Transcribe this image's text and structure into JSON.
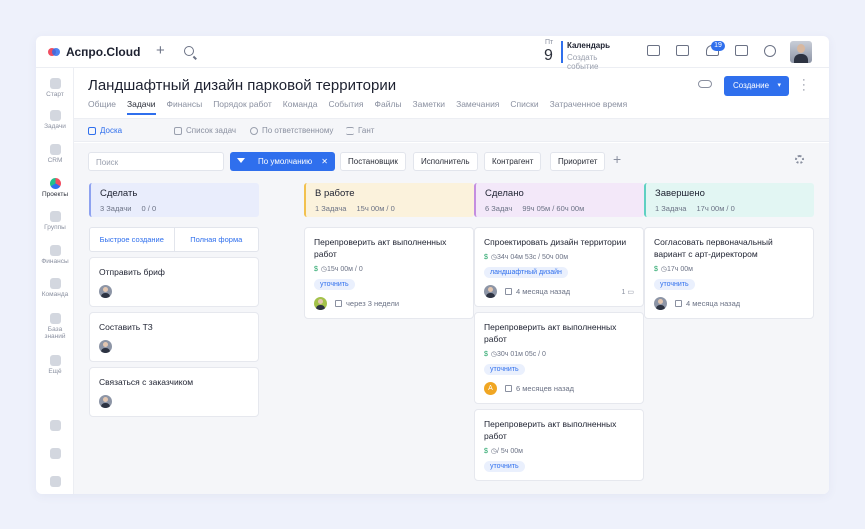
{
  "app": {
    "name": "Аспро.Cloud"
  },
  "calendar": {
    "weekday": "Пт",
    "day": "9",
    "title": "Календарь",
    "subtitle": "Создать событие"
  },
  "notifications": {
    "count": "19"
  },
  "sidebar": {
    "items": [
      {
        "label": "Старт",
        "icon": "home-icon"
      },
      {
        "label": "Задачи",
        "icon": "check-icon"
      },
      {
        "label": "CRM",
        "icon": "crm-icon"
      },
      {
        "label": "Проекты",
        "icon": "projects-icon",
        "active": true
      },
      {
        "label": "Группы",
        "icon": "groups-icon"
      },
      {
        "label": "Финансы",
        "icon": "finance-icon"
      },
      {
        "label": "Команда",
        "icon": "team-icon"
      },
      {
        "label": "База знаний",
        "icon": "knowledge-icon"
      },
      {
        "label": "Ещё",
        "icon": "more-grid-icon"
      }
    ]
  },
  "project": {
    "title": "Ландшафтный дизайн парковой территории",
    "create_label": "Создание",
    "tabs": [
      "Общие",
      "Задачи",
      "Финансы",
      "Порядок работ",
      "Команда",
      "События",
      "Файлы",
      "Заметки",
      "Замечания",
      "Списки",
      "Затраченное время"
    ],
    "active_tab": "Задачи"
  },
  "views": {
    "board": "Доска",
    "list": "Список задач",
    "assignee": "По ответственному",
    "gantt": "Гант"
  },
  "filters": {
    "search_placeholder": "Поиск",
    "default": "По умолчанию",
    "chips": [
      "Постановщик",
      "Исполнитель",
      "Контрагент",
      "Приоритет"
    ]
  },
  "columns": [
    {
      "title": "Сделать",
      "count": "3 Задачи",
      "time": "0 / 0",
      "color": "#8ea2f0",
      "bg": "#e9edfc",
      "quick_create": "Быстрое создание",
      "full_form": "Полная форма",
      "cards": [
        {
          "title": "Отправить бриф"
        },
        {
          "title": "Составить ТЗ"
        },
        {
          "title": "Связаться с заказчиком"
        }
      ]
    },
    {
      "title": "В работе",
      "count": "1 Задача",
      "time": "15ч 00м / 0",
      "color": "#f2c14e",
      "bg": "#fbf2dc",
      "cards": [
        {
          "title": "Перепроверить акт выполненных работ",
          "time": "15ч 00м / 0",
          "tag": "уточнить",
          "due": "через 3 недели"
        }
      ]
    },
    {
      "title": "Сделано",
      "count": "6 Задач",
      "time": "99ч 05м / 60ч 00м",
      "color": "#c48ee0",
      "bg": "#f3e8f9",
      "cards": [
        {
          "title": "Спроектировать дизайн территории",
          "time": "34ч 04м 53с / 50ч 00м",
          "tag": "ландшафтный дизайн",
          "due": "4 месяца назад",
          "comments": "1"
        },
        {
          "title": "Перепроверить акт выполненных работ",
          "time": "30ч 01м 05с / 0",
          "tag": "уточнить",
          "due": "6 месяцев назад",
          "avatar": "А"
        },
        {
          "title": "Перепроверить акт выполненных работ",
          "time": "/ 5ч 00м",
          "tag": "уточнить"
        }
      ]
    },
    {
      "title": "Завершено",
      "count": "1 Задача",
      "time": "17ч 00м / 0",
      "color": "#5fd0c2",
      "bg": "#e2f6f3",
      "cards": [
        {
          "title": "Согласовать первоначальный вариант с арт-директором",
          "time": "17ч 00м",
          "tag": "уточнить",
          "due": "4 месяца назад"
        }
      ]
    }
  ]
}
